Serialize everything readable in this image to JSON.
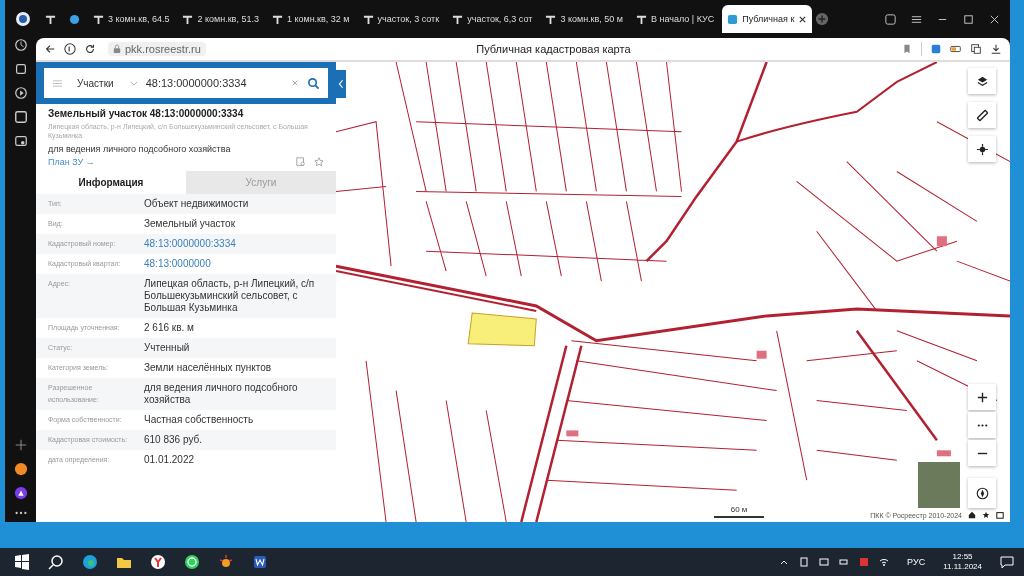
{
  "browser": {
    "tabs": [
      {
        "title": "3 комн.кв, 64.5",
        "selected": false
      },
      {
        "title": "2 комн.кв, 51.3",
        "selected": false
      },
      {
        "title": "1 комн.кв, 32 м",
        "selected": false
      },
      {
        "title": "участок, 3 сотк",
        "selected": false
      },
      {
        "title": "участок, 6,3 сот",
        "selected": false
      },
      {
        "title": "3 комн.кв, 50 м",
        "selected": false
      },
      {
        "title": "В начало | КУС",
        "selected": false
      },
      {
        "title": "Публичная к",
        "selected": true
      }
    ],
    "address": "pkk.rosreestr.ru",
    "page_title": "Публичная кадастровая карта"
  },
  "panel": {
    "search": {
      "category": "Участки",
      "value": "48:13:0000000:3334"
    },
    "title": "Земельный участок 48:13:0000000:3334",
    "address": "Липецкая область, р-н Липецкий, с/п Большекузьминский сельсовет, с Большая Кузьминка",
    "purpose": "для ведения личного подсобного хозяйства",
    "plan_link": "План ЗУ →",
    "tabs": [
      {
        "label": "Информация",
        "selected": true
      },
      {
        "label": "Услуги",
        "selected": false
      }
    ],
    "rows": [
      {
        "label": "Тип:",
        "value": "Объект недвижимости",
        "kind": "text"
      },
      {
        "label": "Вид:",
        "value": "Земельный участок",
        "kind": "text"
      },
      {
        "label": "Кадастровый номер:",
        "value": "48:13:0000000:3334",
        "kind": "link"
      },
      {
        "label": "Кадастровый квартал:",
        "value": "48:13:0000000",
        "kind": "link"
      },
      {
        "label": "Адрес:",
        "value": "Липецкая область, р-н Липецкий, с/п Большекузьминский сельсовет, с Большая Кузьминка",
        "kind": "text"
      },
      {
        "label": "Площадь уточненная:",
        "value": "2 616 кв. м",
        "kind": "text"
      },
      {
        "label": "Статус:",
        "value": "Учтенный",
        "kind": "text"
      },
      {
        "label": "Категория земель:",
        "value": "Земли населённых пунктов",
        "kind": "text"
      },
      {
        "label": "Разрешенное использование:",
        "value": "для ведения личного подсобного хозяйства",
        "kind": "text"
      },
      {
        "label": "Форма собственности:",
        "value": "Частная собственность",
        "kind": "text"
      },
      {
        "label": "Кадастровая стоимость:",
        "value": "610 836 руб.",
        "kind": "text"
      },
      {
        "label": "дата определения:",
        "value": "01.01.2022",
        "kind": "text"
      }
    ]
  },
  "map": {
    "scale": "60 м",
    "attribution": "ПКК © Росреестр 2010-2024"
  },
  "taskbar": {
    "language": "РУС",
    "time": "12:55",
    "date": "11.11.2024"
  }
}
